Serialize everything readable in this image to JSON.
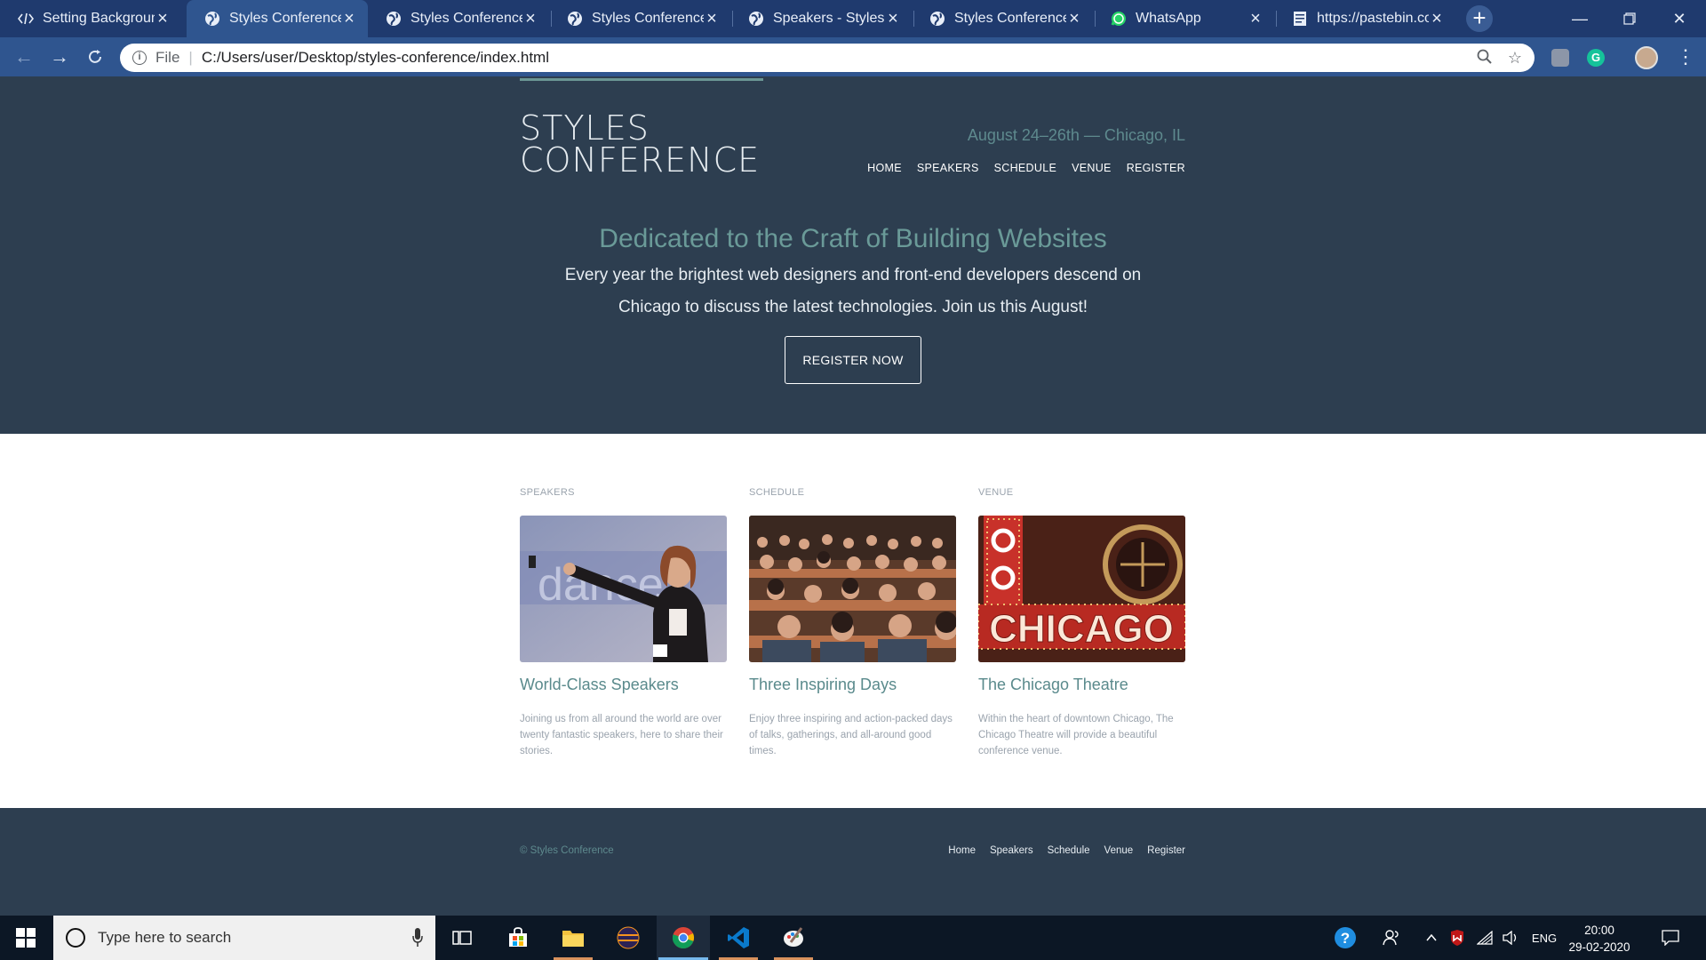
{
  "browser": {
    "tabs": [
      {
        "title": "Setting Background",
        "icon": "code-icon",
        "active": false
      },
      {
        "title": "Styles Conference",
        "icon": "globe-icon",
        "active": true
      },
      {
        "title": "Styles Conference",
        "icon": "globe-icon",
        "active": false
      },
      {
        "title": "Styles Conference",
        "icon": "globe-icon",
        "active": false
      },
      {
        "title": "Speakers - Styles Conference",
        "icon": "globe-icon",
        "active": false
      },
      {
        "title": "Styles Conference",
        "icon": "globe-icon",
        "active": false
      },
      {
        "title": "WhatsApp",
        "icon": "whatsapp-icon",
        "active": false
      },
      {
        "title": "https://pastebin.com",
        "icon": "pastebin-icon",
        "active": false
      }
    ],
    "address": {
      "scheme_label": "File",
      "url": "C:/Users/user/Desktop/styles-conference/index.html"
    }
  },
  "site": {
    "logo_line1": "STYLES",
    "logo_line2": "CONFERENCE",
    "tagline": "August 24–26th — Chicago, IL",
    "nav": [
      "HOME",
      "SPEAKERS",
      "SCHEDULE",
      "VENUE",
      "REGISTER"
    ],
    "hero_title": "Dedicated to the Craft of Building Websites",
    "hero_text": "Every year the brightest web designers and front-end developers descend on Chicago to discuss the latest technologies. Join us this August!",
    "cta": "REGISTER NOW",
    "features": [
      {
        "label": "SPEAKERS",
        "title": "World-Class Speakers",
        "text": "Joining us from all around the world are over twenty fantastic speakers, here to share their stories."
      },
      {
        "label": "SCHEDULE",
        "title": "Three Inspiring Days",
        "text": "Enjoy three inspiring and action-packed days of talks, gatherings, and all-around good times."
      },
      {
        "label": "VENUE",
        "title": "The Chicago Theatre",
        "text": "Within the heart of downtown Chicago, The Chicago Theatre will provide a beautiful conference venue."
      }
    ],
    "venue_sign": "CHICAGO",
    "speaker_slide_text": "dance",
    "copyright": "© Styles Conference",
    "footer_nav": [
      "Home",
      "Speakers",
      "Schedule",
      "Venue",
      "Register"
    ]
  },
  "taskbar": {
    "search_placeholder": "Type here to search",
    "tray": {
      "language": "ENG"
    },
    "time": "20:00",
    "date": "29-02-2020"
  },
  "colors": {
    "hero_bg": "#2d3e50",
    "accent": "#6a9a98",
    "tab_strip": "#1f3a6e",
    "toolbar": "#2f558f"
  }
}
